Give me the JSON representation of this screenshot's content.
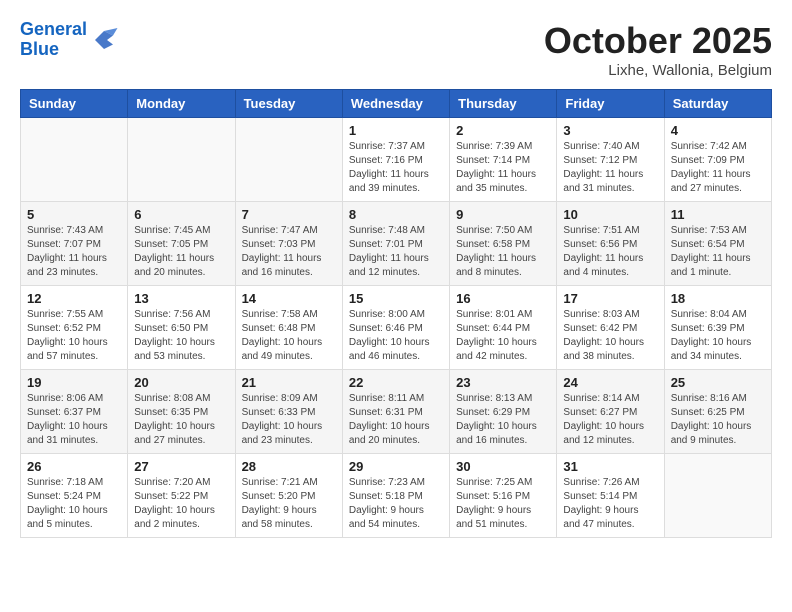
{
  "header": {
    "logo_line1": "General",
    "logo_line2": "Blue",
    "month_title": "October 2025",
    "location": "Lixhe, Wallonia, Belgium"
  },
  "weekdays": [
    "Sunday",
    "Monday",
    "Tuesday",
    "Wednesday",
    "Thursday",
    "Friday",
    "Saturday"
  ],
  "weeks": [
    [
      {
        "day": "",
        "info": ""
      },
      {
        "day": "",
        "info": ""
      },
      {
        "day": "",
        "info": ""
      },
      {
        "day": "1",
        "info": "Sunrise: 7:37 AM\nSunset: 7:16 PM\nDaylight: 11 hours\nand 39 minutes."
      },
      {
        "day": "2",
        "info": "Sunrise: 7:39 AM\nSunset: 7:14 PM\nDaylight: 11 hours\nand 35 minutes."
      },
      {
        "day": "3",
        "info": "Sunrise: 7:40 AM\nSunset: 7:12 PM\nDaylight: 11 hours\nand 31 minutes."
      },
      {
        "day": "4",
        "info": "Sunrise: 7:42 AM\nSunset: 7:09 PM\nDaylight: 11 hours\nand 27 minutes."
      }
    ],
    [
      {
        "day": "5",
        "info": "Sunrise: 7:43 AM\nSunset: 7:07 PM\nDaylight: 11 hours\nand 23 minutes."
      },
      {
        "day": "6",
        "info": "Sunrise: 7:45 AM\nSunset: 7:05 PM\nDaylight: 11 hours\nand 20 minutes."
      },
      {
        "day": "7",
        "info": "Sunrise: 7:47 AM\nSunset: 7:03 PM\nDaylight: 11 hours\nand 16 minutes."
      },
      {
        "day": "8",
        "info": "Sunrise: 7:48 AM\nSunset: 7:01 PM\nDaylight: 11 hours\nand 12 minutes."
      },
      {
        "day": "9",
        "info": "Sunrise: 7:50 AM\nSunset: 6:58 PM\nDaylight: 11 hours\nand 8 minutes."
      },
      {
        "day": "10",
        "info": "Sunrise: 7:51 AM\nSunset: 6:56 PM\nDaylight: 11 hours\nand 4 minutes."
      },
      {
        "day": "11",
        "info": "Sunrise: 7:53 AM\nSunset: 6:54 PM\nDaylight: 11 hours\nand 1 minute."
      }
    ],
    [
      {
        "day": "12",
        "info": "Sunrise: 7:55 AM\nSunset: 6:52 PM\nDaylight: 10 hours\nand 57 minutes."
      },
      {
        "day": "13",
        "info": "Sunrise: 7:56 AM\nSunset: 6:50 PM\nDaylight: 10 hours\nand 53 minutes."
      },
      {
        "day": "14",
        "info": "Sunrise: 7:58 AM\nSunset: 6:48 PM\nDaylight: 10 hours\nand 49 minutes."
      },
      {
        "day": "15",
        "info": "Sunrise: 8:00 AM\nSunset: 6:46 PM\nDaylight: 10 hours\nand 46 minutes."
      },
      {
        "day": "16",
        "info": "Sunrise: 8:01 AM\nSunset: 6:44 PM\nDaylight: 10 hours\nand 42 minutes."
      },
      {
        "day": "17",
        "info": "Sunrise: 8:03 AM\nSunset: 6:42 PM\nDaylight: 10 hours\nand 38 minutes."
      },
      {
        "day": "18",
        "info": "Sunrise: 8:04 AM\nSunset: 6:39 PM\nDaylight: 10 hours\nand 34 minutes."
      }
    ],
    [
      {
        "day": "19",
        "info": "Sunrise: 8:06 AM\nSunset: 6:37 PM\nDaylight: 10 hours\nand 31 minutes."
      },
      {
        "day": "20",
        "info": "Sunrise: 8:08 AM\nSunset: 6:35 PM\nDaylight: 10 hours\nand 27 minutes."
      },
      {
        "day": "21",
        "info": "Sunrise: 8:09 AM\nSunset: 6:33 PM\nDaylight: 10 hours\nand 23 minutes."
      },
      {
        "day": "22",
        "info": "Sunrise: 8:11 AM\nSunset: 6:31 PM\nDaylight: 10 hours\nand 20 minutes."
      },
      {
        "day": "23",
        "info": "Sunrise: 8:13 AM\nSunset: 6:29 PM\nDaylight: 10 hours\nand 16 minutes."
      },
      {
        "day": "24",
        "info": "Sunrise: 8:14 AM\nSunset: 6:27 PM\nDaylight: 10 hours\nand 12 minutes."
      },
      {
        "day": "25",
        "info": "Sunrise: 8:16 AM\nSunset: 6:25 PM\nDaylight: 10 hours\nand 9 minutes."
      }
    ],
    [
      {
        "day": "26",
        "info": "Sunrise: 7:18 AM\nSunset: 5:24 PM\nDaylight: 10 hours\nand 5 minutes."
      },
      {
        "day": "27",
        "info": "Sunrise: 7:20 AM\nSunset: 5:22 PM\nDaylight: 10 hours\nand 2 minutes."
      },
      {
        "day": "28",
        "info": "Sunrise: 7:21 AM\nSunset: 5:20 PM\nDaylight: 9 hours\nand 58 minutes."
      },
      {
        "day": "29",
        "info": "Sunrise: 7:23 AM\nSunset: 5:18 PM\nDaylight: 9 hours\nand 54 minutes."
      },
      {
        "day": "30",
        "info": "Sunrise: 7:25 AM\nSunset: 5:16 PM\nDaylight: 9 hours\nand 51 minutes."
      },
      {
        "day": "31",
        "info": "Sunrise: 7:26 AM\nSunset: 5:14 PM\nDaylight: 9 hours\nand 47 minutes."
      },
      {
        "day": "",
        "info": ""
      }
    ]
  ]
}
